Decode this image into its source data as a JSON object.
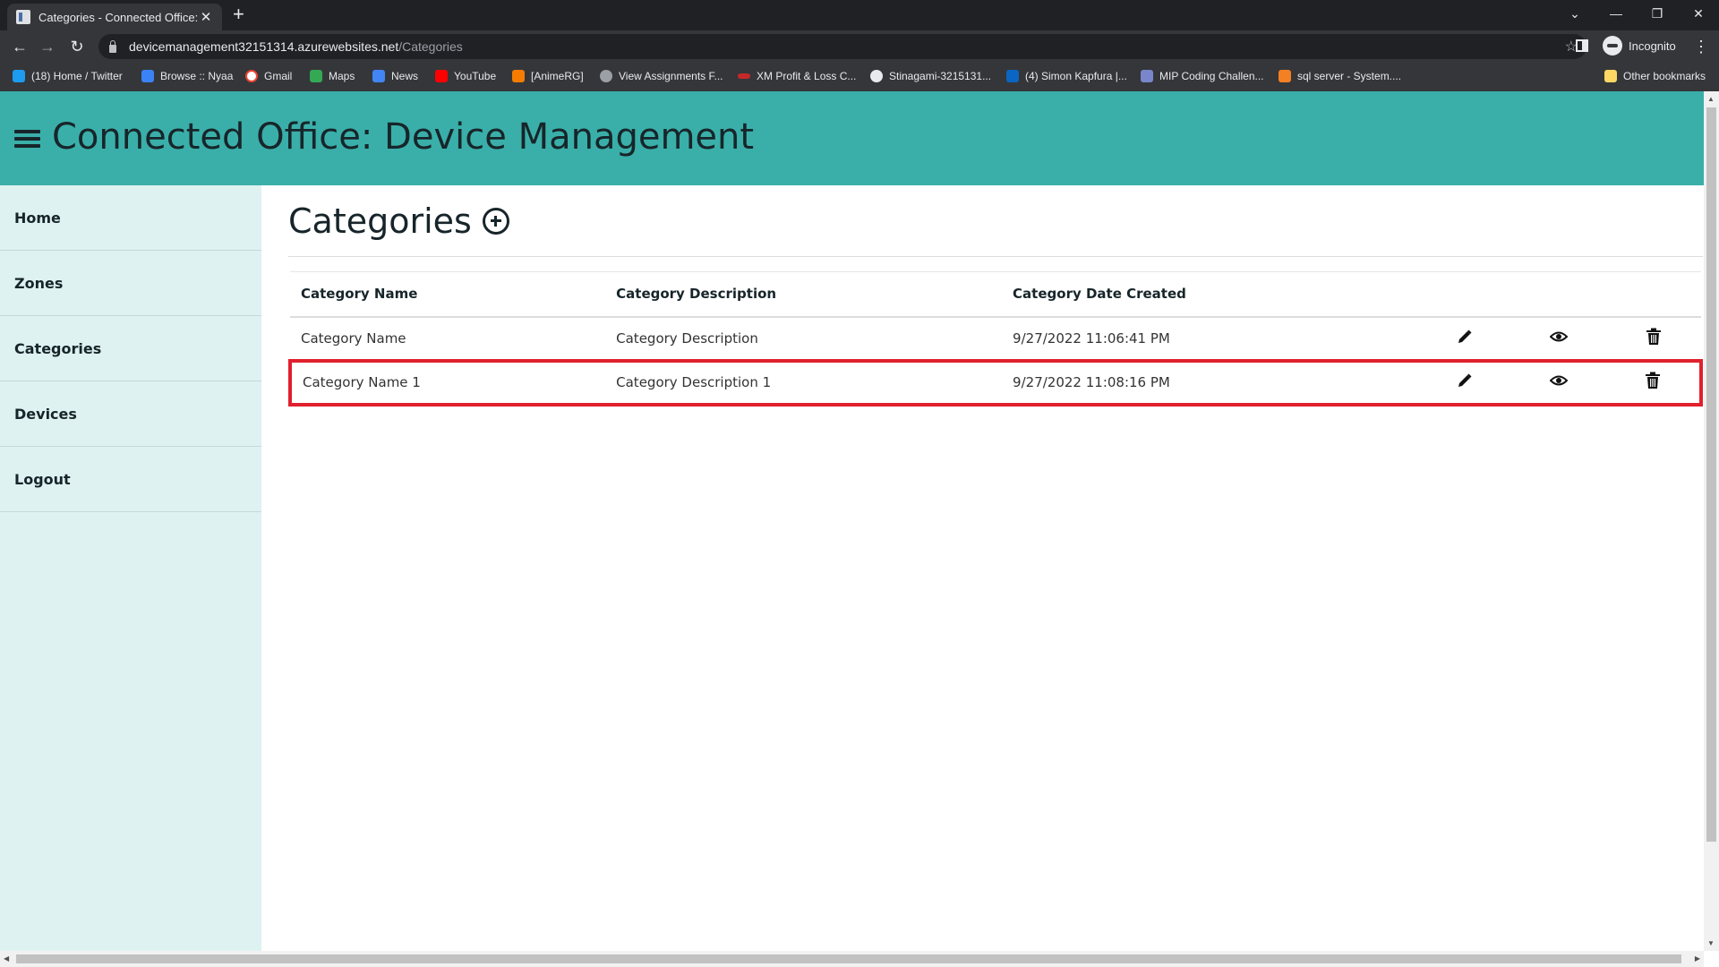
{
  "browser": {
    "tab_title": "Categories - Connected Office: D",
    "url_host": "devicemanagement32151314.azurewebsites.net",
    "url_path": "/Categories",
    "profile_label": "Incognito",
    "bookmarks": [
      {
        "label": "(18) Home / Twitter",
        "color": "#1d9bf0"
      },
      {
        "label": "Browse :: Nyaa",
        "color": "#3b82f6"
      },
      {
        "label": "Gmail",
        "color": "#ea4335"
      },
      {
        "label": "Maps",
        "color": "#34a853"
      },
      {
        "label": "News",
        "color": "#4285f4"
      },
      {
        "label": "YouTube",
        "color": "#ff0000"
      },
      {
        "label": "[AnimeRG]",
        "color": "#f57c00"
      },
      {
        "label": "View Assignments F...",
        "color": "#9aa0a6"
      },
      {
        "label": "XM Profit & Loss C...",
        "color": "#c62828"
      },
      {
        "label": "Stinagami-3215131...",
        "color": "#e8eaed"
      },
      {
        "label": "(4) Simon Kapfura |...",
        "color": "#0a66c2"
      },
      {
        "label": "MIP Coding Challen...",
        "color": "#7986cb"
      },
      {
        "label": "sql server - System....",
        "color": "#f48024"
      }
    ],
    "other_bookmarks": "Other bookmarks"
  },
  "header": {
    "title": "Connected Office: Device Management"
  },
  "sidebar": {
    "items": [
      {
        "label": "Home"
      },
      {
        "label": "Zones"
      },
      {
        "label": "Categories"
      },
      {
        "label": "Devices"
      },
      {
        "label": "Logout"
      }
    ]
  },
  "main": {
    "title": "Categories",
    "columns": [
      "Category Name",
      "Category Description",
      "Category Date Created"
    ],
    "rows": [
      {
        "name": "Category Name",
        "description": "Category Description",
        "date": "9/27/2022 11:06:41 PM"
      },
      {
        "name": "Category Name 1",
        "description": "Category Description 1",
        "date": "9/27/2022 11:08:16 PM"
      }
    ],
    "highlighted_row": 1,
    "highlight_color": "#e0202d"
  },
  "colors": {
    "header_bg": "#3aafa9",
    "sidebar_bg": "#def2f1",
    "text_dark": "#17252a"
  }
}
